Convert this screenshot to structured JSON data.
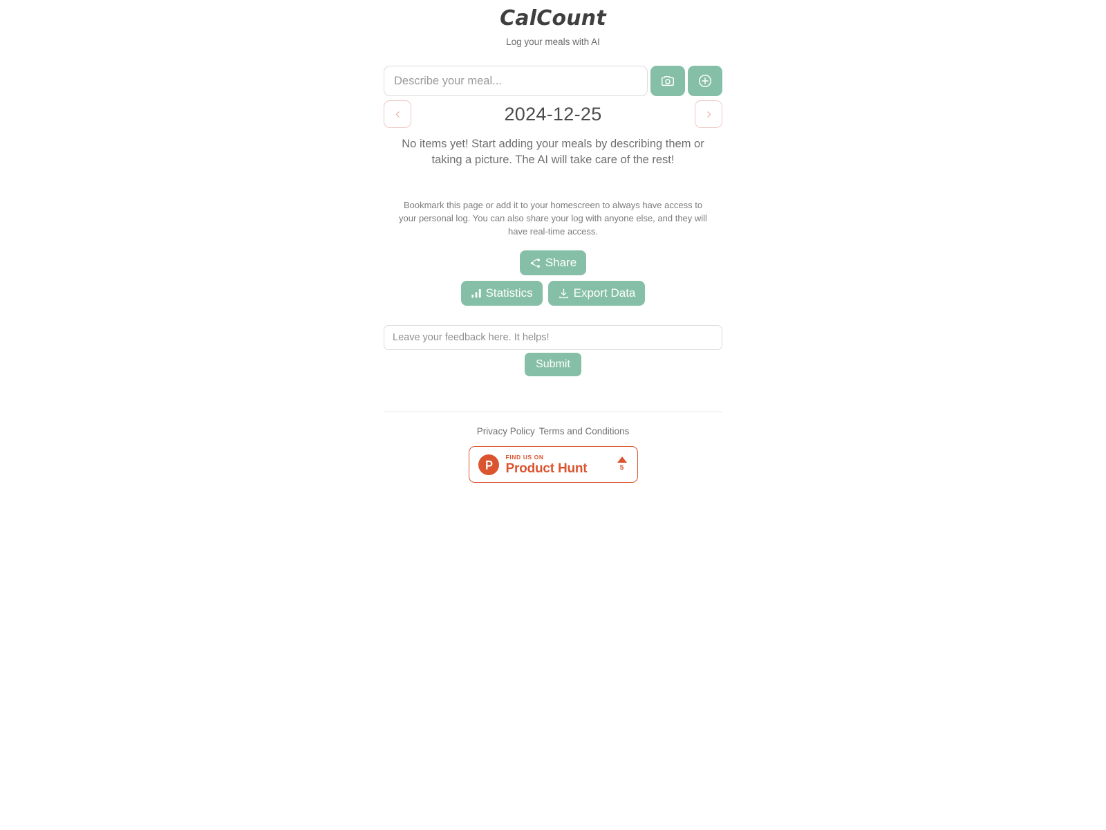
{
  "header": {
    "title": "CalCount",
    "tagline": "Log your meals with AI"
  },
  "meal_input": {
    "placeholder": "Describe your meal...",
    "value": "",
    "camera_icon": "camera-icon",
    "add_icon": "circle-plus-icon"
  },
  "date_nav": {
    "prev_icon": "chevron-left-icon",
    "next_icon": "chevron-right-icon",
    "current_date": "2024-12-25"
  },
  "empty_state": {
    "message": "No items yet! Start adding your meals by describing them or taking a picture. The AI will take care of the rest!"
  },
  "bookmark_note": {
    "text": "Bookmark this page or add it to your homescreen to always have access to your personal log. You can also share your log with anyone else, and they will have real-time access."
  },
  "actions": {
    "share_label": "Share",
    "share_icon": "share-nodes-icon",
    "statistics_label": "Statistics",
    "statistics_icon": "bar-chart-icon",
    "export_label": "Export Data",
    "export_icon": "download-icon"
  },
  "feedback": {
    "placeholder": "Leave your feedback here. It helps!",
    "value": "",
    "submit_label": "Submit"
  },
  "footer": {
    "privacy_label": "Privacy Policy",
    "terms_label": "Terms and Conditions"
  },
  "product_hunt": {
    "eyebrow": "FIND US ON",
    "name": "Product Hunt",
    "vote_count": "5",
    "logo_icon": "product-hunt-logo-icon",
    "upvote_icon": "caret-up-icon"
  },
  "colors": {
    "accent_green": "#86bfa7",
    "product_hunt_orange": "#DA552F",
    "nav_border_pink": "#f0c9c5",
    "text_dark": "#4a4a4a",
    "text_muted": "#7a7a7a",
    "background": "#ffffff"
  }
}
